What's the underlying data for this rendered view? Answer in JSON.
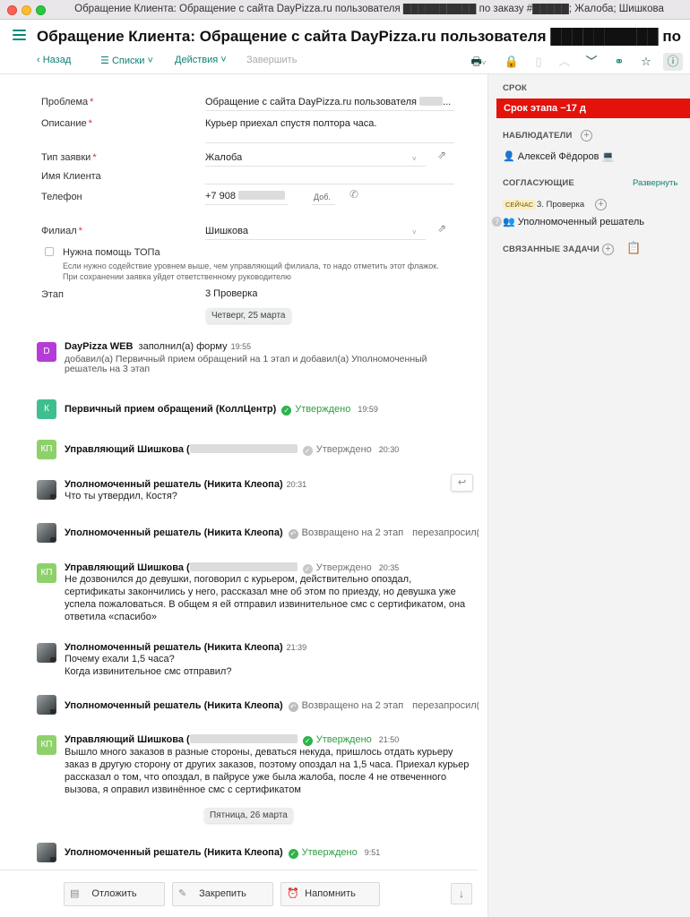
{
  "window": {
    "title": "Обращение Клиента: Обращение с сайта DayPizza.ru пользователя ██████████ по заказу #█████; Жалоба; Шишкова"
  },
  "header": {
    "title": "Обращение Клиента: Обращение с сайта DayPizza.ru пользователя ██████████ по заказу #█████;..."
  },
  "toolbar": {
    "back": "Назад",
    "lists": "Списки",
    "actions": "Действия",
    "finish": "Завершить",
    "icons": [
      "print-icon",
      "lock-icon",
      "document-icon",
      "chevron-up-icon",
      "chevron-down-icon",
      "link-icon",
      "star-icon",
      "info-icon"
    ]
  },
  "form": {
    "problem_label": "Проблема",
    "problem_value": "Обращение с сайта DayPizza.ru пользователя",
    "problem_tail": "...",
    "description_label": "Описание",
    "description_value": "Курьер приехал спустя полтора часа.",
    "type_label": "Тип заявки",
    "type_value": "Жалоба",
    "client_name_label": "Имя Клиента",
    "phone_label": "Телефон",
    "phone_value": "+7 908",
    "ext_label": "Доб.",
    "branch_label": "Филиал",
    "branch_value": "Шишкова",
    "top_help_label": "Нужна помощь ТОПа",
    "top_help_hint1": "Если нужно содействие уровнем выше, чем управляющий филиала, то надо отметить этот флажок.",
    "top_help_hint2": "При сохранении заявка уйдет ответственному руководителю",
    "stage_label": "Этап",
    "stage_value": "3 Проверка",
    "required_mark": "*"
  },
  "feed": {
    "date1": "Четверг, 25 марта",
    "date2": "Пятница, 26 марта",
    "e1": {
      "avatar": "D",
      "avatar_color": "#b63cd6",
      "author": "DayPizza WEB",
      "action": "заполнил(а) форму",
      "time": "19:55",
      "line1": "добавил(а) Первичный прием обращений на 1 этап и добавил(а) Уполномоченный",
      "line2": "решатель на 3 этап"
    },
    "e2": {
      "avatar": "К",
      "avatar_color": "#3fbf8f",
      "author": "Первичный прием обращений (КоллЦентр)",
      "status": "Утверждено",
      "time": "19:59"
    },
    "e3": {
      "avatar": "КП",
      "avatar_color": "#8ed16b",
      "author": "Управляющий Шишкова (",
      "status": "Утверждено",
      "time": "20:30"
    },
    "e4": {
      "author": "Уполномоченный решатель (Никита Клеопа)",
      "time": "20:31",
      "text": "Что ты утвердил, Костя?"
    },
    "e5": {
      "author": "Уполномоченный решатель (Никита Клеопа)",
      "status": "Возвращено на 2 этап",
      "extra": "перезапросил(а) со"
    },
    "e6": {
      "avatar": "КП",
      "author": "Управляющий Шишкова (",
      "status": "Утверждено",
      "time": "20:35",
      "l1": "Не дозвонился до девушки, поговорил с курьером, действительно опоздал,",
      "l2": "сертификаты закончились у него, рассказал мне об этом по приезду, но девушка уже",
      "l3": "успела пожаловаться. В общем я ей отправил извинительное смс с сертификатом, она",
      "l4": "ответила «спасибо»"
    },
    "e7": {
      "author": "Уполномоченный решатель (Никита Клеопа)",
      "time": "21:39",
      "l1": "Почему ехали 1,5 часа?",
      "l2": "Когда извинительное смс отправил?"
    },
    "e8": {
      "author": "Уполномоченный решатель (Никита Клеопа)",
      "status": "Возвращено на 2 этап",
      "extra": "перезапросил(а) со"
    },
    "e9": {
      "avatar": "КП",
      "author": "Управляющий Шишкова (",
      "status": "Утверждено",
      "time": "21:50",
      "l1": "Вышло много заказов в разные стороны, деваться некуда, пришлось отдать курьеру",
      "l2": "заказ в другую сторону от других заказов, поэтому опоздал на 1,5 часа. Приехал курьер",
      "l3": "рассказал о том, что опоздал, в пайрусе уже была жалоба, после 4 не отвеченного",
      "l4": "вызова, я оправил извинённое смс с сертификатом"
    },
    "e10": {
      "author": "Уполномоченный решатель (Никита Клеопа)",
      "status": "Утверждено",
      "time": "9:51"
    }
  },
  "bottom": {
    "postpone": "Отложить",
    "pin": "Закрепить",
    "remind": "Напомнить"
  },
  "right_panel": {
    "deadline_header": "СРОК",
    "deadline_value": "Срок этапа −17 д",
    "watchers_header": "НАБЛЮДАТЕЛИ",
    "watcher_name": "Алексей Фёдоров",
    "approvals_header": "СОГЛАСУЮЩИЕ",
    "expand_label": "Развернуть",
    "now_badge": "СЕЙЧАС",
    "approval_stage": "3. Проверка",
    "approver": "Уполномоченный решатель",
    "related_header": "СВЯЗАННЫЕ ЗАДАЧИ",
    "accent_color": "#e3120b"
  }
}
